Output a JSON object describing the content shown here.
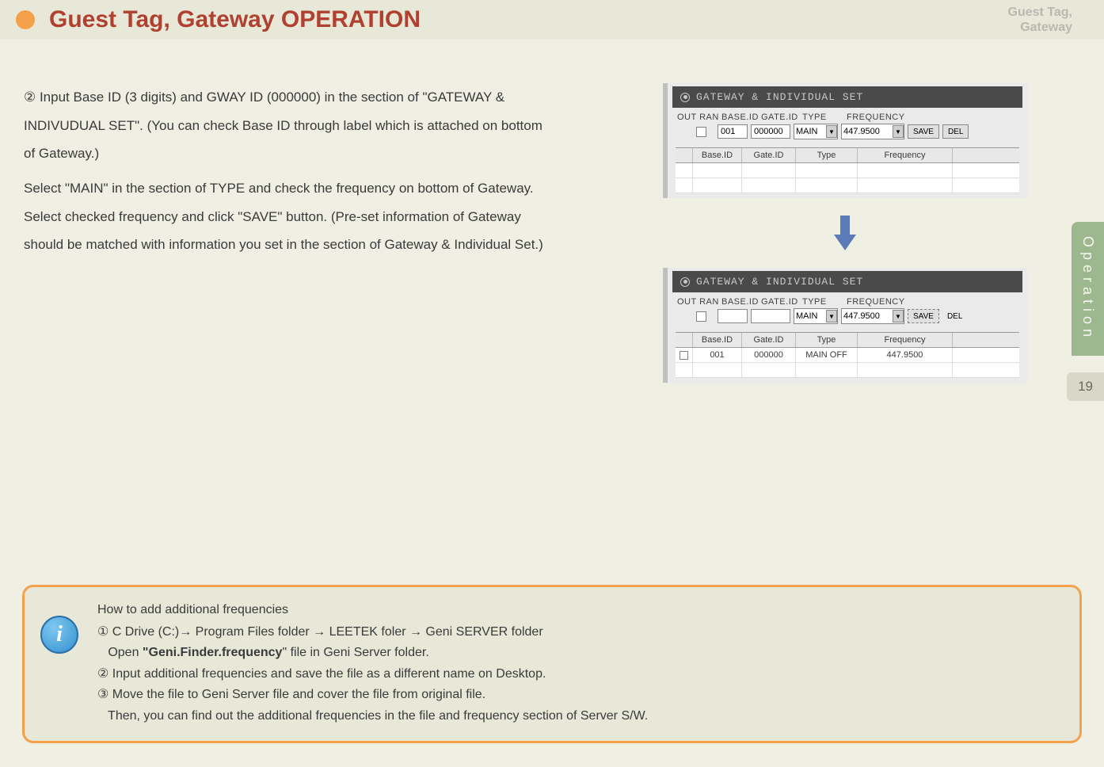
{
  "header": {
    "title": "Guest Tag, Gateway OPERATION",
    "crumb_line1": "Guest Tag,",
    "crumb_line2": "Gateway"
  },
  "body": {
    "p1": "② Input Base ID (3 digits) and GWAY ID (000000) in the section of \"GATEWAY & INDIVUDUAL SET\". (You can check Base ID through label which is attached on bottom of Gateway.)",
    "p2": " Select \"MAIN\" in the section of TYPE and check the frequency on bottom of Gateway. Select checked frequency and click \"SAVE\" button. (Pre-set information of Gateway should be matched with information you set in the section of Gateway & Individual Set.)"
  },
  "panel": {
    "title": "GATEWAY & INDIVIDUAL SET",
    "labels": {
      "outran": "OUT RAN",
      "base": "BASE.ID",
      "gate": "GATE.ID",
      "type": "TYPE",
      "freq": "FREQUENCY"
    },
    "top": {
      "base_id": "001",
      "gate_id": "000000",
      "type": "MAIN",
      "freq": "447.9500",
      "save": "SAVE",
      "del": "DEL"
    },
    "bottom": {
      "base_id": "",
      "gate_id": "",
      "type": "MAIN",
      "freq": "447.9500",
      "save": "SAVE",
      "del": "DEL"
    },
    "table_headers": {
      "base": "Base.ID",
      "gate": "Gate.ID",
      "type": "Type",
      "freq": "Frequency"
    },
    "table_row": {
      "base": "001",
      "gate": "000000",
      "type": "MAIN OFF",
      "freq": "447.9500"
    }
  },
  "side": {
    "tab": "Operation",
    "page": "19"
  },
  "info": {
    "title": "How to add additional frequencies",
    "l1_prefix": "① C Drive (C:)→ Program Files folder → LEETEK foler → Geni SERVER folder",
    "l2_a": "   Open ",
    "l2_bold": "\"Geni.Finder.frequency",
    "l2_b": "\" file in Geni Server folder.",
    "l3": "② Input additional frequencies and save the file as a different name on Desktop.",
    "l4": "③ Move the file to Geni Server file and cover the file from original file.",
    "l5": "   Then, you can find out the additional frequencies in the file and frequency section of Server S/W."
  }
}
